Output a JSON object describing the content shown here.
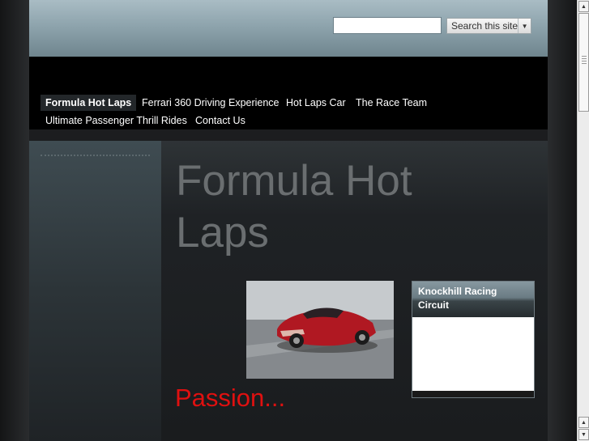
{
  "header": {
    "search": {
      "value": "",
      "placeholder": "",
      "button_label": "Search this site"
    }
  },
  "nav": {
    "items": [
      {
        "label": "Formula Hot Laps",
        "active": true
      },
      {
        "label": "Ferrari 360 Driving Experience",
        "active": false
      },
      {
        "label": "Hot Laps Car",
        "active": false
      },
      {
        "label": "The Race Team",
        "active": false
      },
      {
        "label": "Ultimate Passenger Thrill Rides",
        "active": false
      },
      {
        "label": "Contact Us",
        "active": false
      }
    ]
  },
  "main": {
    "title": "Formula Hot Laps",
    "tagline": "Passion...",
    "map_gadget": {
      "title": "Knockhill Racing Circuit"
    }
  },
  "colors": {
    "accent_red": "#e01010",
    "header_steel": "#8ea4ad",
    "nav_bg": "#000000"
  }
}
